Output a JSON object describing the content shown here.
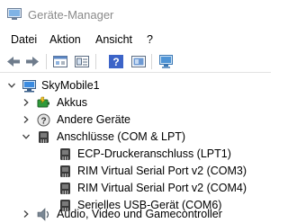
{
  "window": {
    "title": "Geräte-Manager"
  },
  "menu": {
    "items": [
      "Datei",
      "Aktion",
      "Ansicht",
      "?"
    ]
  },
  "toolbar": {
    "buttons": [
      "back-arrow-icon",
      "forward-arrow-icon",
      "properties-icon",
      "show-hidden-icon",
      "help-icon",
      "driver-details-icon",
      "scan-hardware-icon"
    ]
  },
  "tree": {
    "root": {
      "label": "SkyMobile1",
      "icon": "computer-icon",
      "expanded": true
    },
    "nodes": [
      {
        "label": "Akkus",
        "icon": "battery-icon",
        "expanded": false
      },
      {
        "label": "Andere Geräte",
        "icon": "unknown-device-icon",
        "expanded": false
      },
      {
        "label": "Anschlüsse (COM & LPT)",
        "icon": "port-icon",
        "expanded": true,
        "children": [
          {
            "label": "ECP-Druckeranschluss (LPT1)",
            "icon": "port-icon"
          },
          {
            "label": "RIM Virtual Serial Port v2 (COM3)",
            "icon": "port-icon"
          },
          {
            "label": "RIM Virtual Serial Port v2 (COM4)",
            "icon": "port-icon"
          },
          {
            "label": "Serielles USB-Gerät (COM6)",
            "icon": "port-icon"
          }
        ]
      },
      {
        "label": "Audio, Video und Gamecontroller",
        "icon": "audio-icon",
        "expanded": false
      }
    ]
  }
}
